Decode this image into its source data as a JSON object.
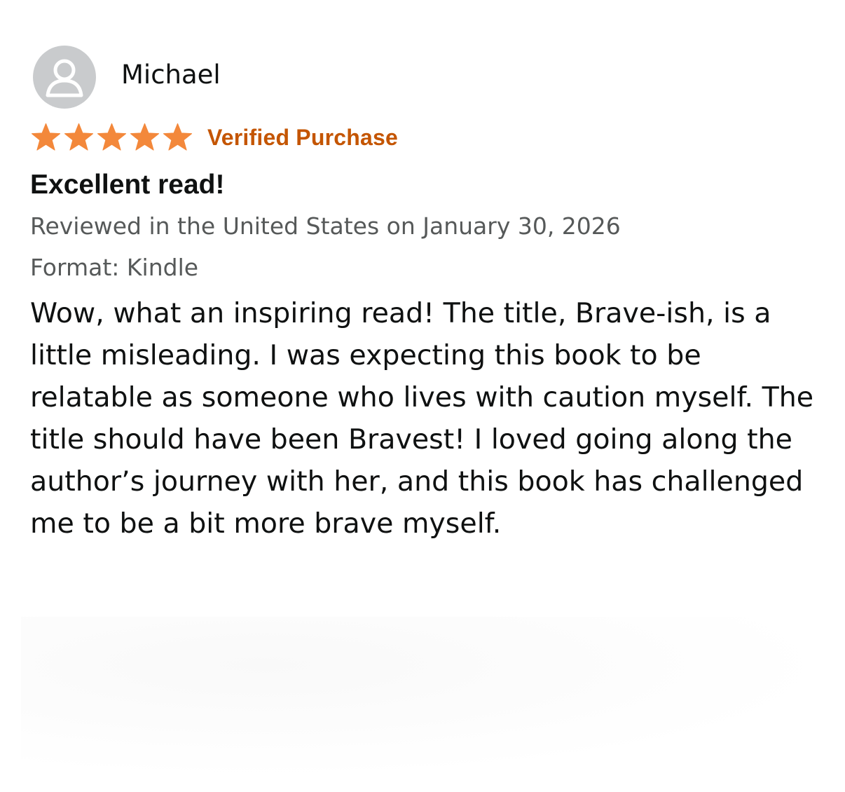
{
  "reviewer": {
    "name": "Michael",
    "avatar_icon": "default-user-icon"
  },
  "rating": {
    "stars": 5,
    "max_stars": 5,
    "star_color": "#f3883b",
    "verified_label": "Verified Purchase",
    "verified_color": "#c45500"
  },
  "review": {
    "title": "Excellent read!",
    "date_line": "Reviewed in the United States on January 30, 2026",
    "format_line": "Format: Kindle",
    "body": "Wow, what an inspiring read! The title, Brave-ish, is a little misleading. I was expecting this book to be relatable as someone who lives with caution myself. The title should have been Bravest! I loved going along the author’s journey with her, and this book has challenged me to be a bit more brave myself."
  }
}
